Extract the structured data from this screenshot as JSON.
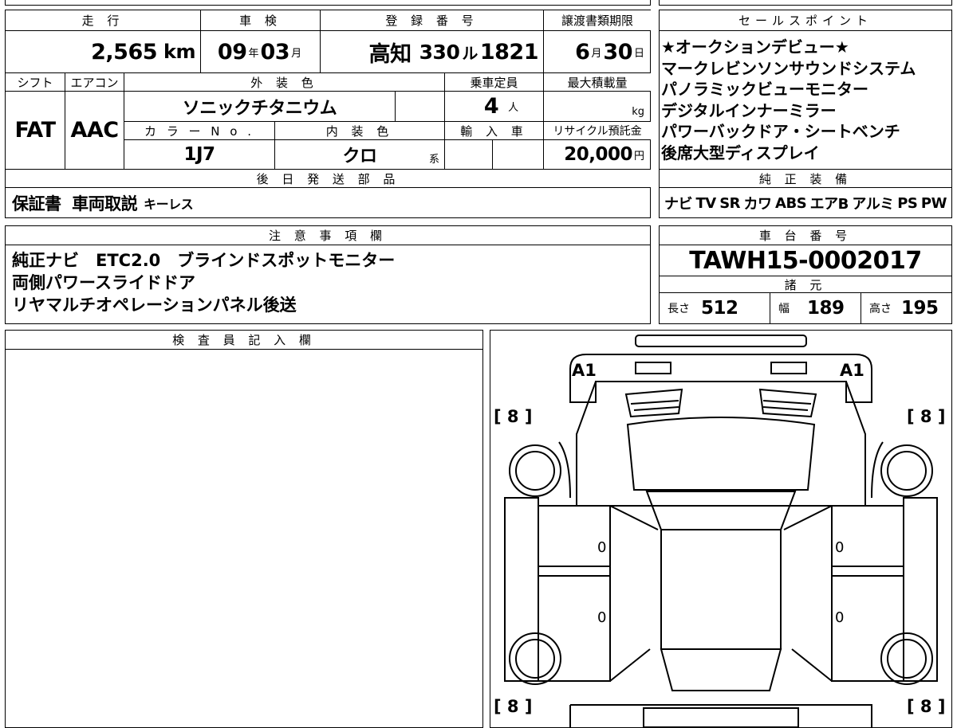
{
  "summary": {
    "mileage_label": "走 行",
    "mileage_value": "2,565",
    "mileage_unit": "km",
    "inspection_label": "車 検",
    "inspection_year": "09",
    "inspection_year_unit": "年",
    "inspection_month": "03",
    "inspection_month_unit": "月",
    "registration_label": "登 録 番 号",
    "registration_area": "高知",
    "registration_class": "330",
    "registration_kana": "ル",
    "registration_number": "1821",
    "transfer_label": "譲渡書類期限",
    "transfer_month": "6",
    "transfer_month_unit": "月",
    "transfer_day": "30",
    "transfer_day_unit": "日"
  },
  "spec": {
    "shift_label": "シフト",
    "shift_value": "FAT",
    "aircon_label": "エアコン",
    "aircon_value": "AAC",
    "exterior_label": "外 装 色",
    "exterior_value": "ソニックチタニウム",
    "capacity_label": "乗車定員",
    "capacity_value": "4",
    "capacity_unit": "人",
    "load_label": "最大積載量",
    "load_unit": "kg",
    "color_no_label": "カ ラ ー N o .",
    "color_no_value": "1J7",
    "interior_label": "内 装 色",
    "interior_value": "クロ",
    "interior_unit": "系",
    "import_label": "輸 入 車",
    "recycle_label": "リサイクル預託金",
    "recycle_value": "20,000",
    "recycle_unit": "円",
    "delivery_label": "後 日 発 送 部 品",
    "delivery_value": "保証書  車両取説",
    "delivery_small": "キーレス"
  },
  "sales": {
    "header": "セールスポイント",
    "items": [
      "★オークションデビュー★",
      "マークレビンソンサウンドシステム",
      "パノラミックビューモニター",
      "デジタルインナーミラー",
      "パワーバックドア・シートベンチ",
      "後席大型ディスプレイ"
    ]
  },
  "equipment": {
    "header": "純 正 装 備",
    "items": [
      "ナビ",
      "TV",
      "SR",
      "カワ",
      "ABS",
      "エアB",
      "アルミ",
      "PS",
      "PW"
    ]
  },
  "notes": {
    "header": "注 意 事 項 欄",
    "lines": [
      "純正ナビ　ETC2.0　ブラインドスポットモニター",
      "両側パワースライドドア",
      "リヤマルチオペレーションパネル後送"
    ]
  },
  "chassis": {
    "header": "車 台 番 号",
    "value": "TAWH15-0002017"
  },
  "dims": {
    "header": "諸 元",
    "length_label": "長さ",
    "length_value": "512",
    "width_label": "幅",
    "width_value": "189",
    "height_label": "高さ",
    "height_value": "195"
  },
  "inspector": {
    "header": "検 査 員 記 入 欄"
  },
  "diagram": {
    "front_left_mark": "A1",
    "front_right_mark": "A1",
    "tire_front_left": "[ 8 ]",
    "tire_front_right": "[ 8 ]",
    "tire_rear_left": "[ 8 ]",
    "tire_rear_right": "[ 8 ]",
    "door_mark_1": "0",
    "door_mark_2": "0",
    "door_mark_3": "0",
    "door_mark_4": "0"
  }
}
